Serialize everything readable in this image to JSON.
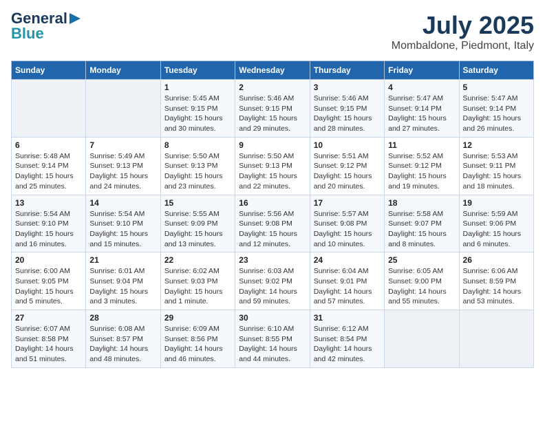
{
  "header": {
    "logo_line1": "General",
    "logo_line2": "Blue",
    "month": "July 2025",
    "location": "Mombaldone, Piedmont, Italy"
  },
  "weekdays": [
    "Sunday",
    "Monday",
    "Tuesday",
    "Wednesday",
    "Thursday",
    "Friday",
    "Saturday"
  ],
  "weeks": [
    [
      {
        "day": "",
        "info": ""
      },
      {
        "day": "",
        "info": ""
      },
      {
        "day": "1",
        "info": "Sunrise: 5:45 AM\nSunset: 9:15 PM\nDaylight: 15 hours\nand 30 minutes."
      },
      {
        "day": "2",
        "info": "Sunrise: 5:46 AM\nSunset: 9:15 PM\nDaylight: 15 hours\nand 29 minutes."
      },
      {
        "day": "3",
        "info": "Sunrise: 5:46 AM\nSunset: 9:15 PM\nDaylight: 15 hours\nand 28 minutes."
      },
      {
        "day": "4",
        "info": "Sunrise: 5:47 AM\nSunset: 9:14 PM\nDaylight: 15 hours\nand 27 minutes."
      },
      {
        "day": "5",
        "info": "Sunrise: 5:47 AM\nSunset: 9:14 PM\nDaylight: 15 hours\nand 26 minutes."
      }
    ],
    [
      {
        "day": "6",
        "info": "Sunrise: 5:48 AM\nSunset: 9:14 PM\nDaylight: 15 hours\nand 25 minutes."
      },
      {
        "day": "7",
        "info": "Sunrise: 5:49 AM\nSunset: 9:13 PM\nDaylight: 15 hours\nand 24 minutes."
      },
      {
        "day": "8",
        "info": "Sunrise: 5:50 AM\nSunset: 9:13 PM\nDaylight: 15 hours\nand 23 minutes."
      },
      {
        "day": "9",
        "info": "Sunrise: 5:50 AM\nSunset: 9:13 PM\nDaylight: 15 hours\nand 22 minutes."
      },
      {
        "day": "10",
        "info": "Sunrise: 5:51 AM\nSunset: 9:12 PM\nDaylight: 15 hours\nand 20 minutes."
      },
      {
        "day": "11",
        "info": "Sunrise: 5:52 AM\nSunset: 9:12 PM\nDaylight: 15 hours\nand 19 minutes."
      },
      {
        "day": "12",
        "info": "Sunrise: 5:53 AM\nSunset: 9:11 PM\nDaylight: 15 hours\nand 18 minutes."
      }
    ],
    [
      {
        "day": "13",
        "info": "Sunrise: 5:54 AM\nSunset: 9:10 PM\nDaylight: 15 hours\nand 16 minutes."
      },
      {
        "day": "14",
        "info": "Sunrise: 5:54 AM\nSunset: 9:10 PM\nDaylight: 15 hours\nand 15 minutes."
      },
      {
        "day": "15",
        "info": "Sunrise: 5:55 AM\nSunset: 9:09 PM\nDaylight: 15 hours\nand 13 minutes."
      },
      {
        "day": "16",
        "info": "Sunrise: 5:56 AM\nSunset: 9:08 PM\nDaylight: 15 hours\nand 12 minutes."
      },
      {
        "day": "17",
        "info": "Sunrise: 5:57 AM\nSunset: 9:08 PM\nDaylight: 15 hours\nand 10 minutes."
      },
      {
        "day": "18",
        "info": "Sunrise: 5:58 AM\nSunset: 9:07 PM\nDaylight: 15 hours\nand 8 minutes."
      },
      {
        "day": "19",
        "info": "Sunrise: 5:59 AM\nSunset: 9:06 PM\nDaylight: 15 hours\nand 6 minutes."
      }
    ],
    [
      {
        "day": "20",
        "info": "Sunrise: 6:00 AM\nSunset: 9:05 PM\nDaylight: 15 hours\nand 5 minutes."
      },
      {
        "day": "21",
        "info": "Sunrise: 6:01 AM\nSunset: 9:04 PM\nDaylight: 15 hours\nand 3 minutes."
      },
      {
        "day": "22",
        "info": "Sunrise: 6:02 AM\nSunset: 9:03 PM\nDaylight: 15 hours\nand 1 minute."
      },
      {
        "day": "23",
        "info": "Sunrise: 6:03 AM\nSunset: 9:02 PM\nDaylight: 14 hours\nand 59 minutes."
      },
      {
        "day": "24",
        "info": "Sunrise: 6:04 AM\nSunset: 9:01 PM\nDaylight: 14 hours\nand 57 minutes."
      },
      {
        "day": "25",
        "info": "Sunrise: 6:05 AM\nSunset: 9:00 PM\nDaylight: 14 hours\nand 55 minutes."
      },
      {
        "day": "26",
        "info": "Sunrise: 6:06 AM\nSunset: 8:59 PM\nDaylight: 14 hours\nand 53 minutes."
      }
    ],
    [
      {
        "day": "27",
        "info": "Sunrise: 6:07 AM\nSunset: 8:58 PM\nDaylight: 14 hours\nand 51 minutes."
      },
      {
        "day": "28",
        "info": "Sunrise: 6:08 AM\nSunset: 8:57 PM\nDaylight: 14 hours\nand 48 minutes."
      },
      {
        "day": "29",
        "info": "Sunrise: 6:09 AM\nSunset: 8:56 PM\nDaylight: 14 hours\nand 46 minutes."
      },
      {
        "day": "30",
        "info": "Sunrise: 6:10 AM\nSunset: 8:55 PM\nDaylight: 14 hours\nand 44 minutes."
      },
      {
        "day": "31",
        "info": "Sunrise: 6:12 AM\nSunset: 8:54 PM\nDaylight: 14 hours\nand 42 minutes."
      },
      {
        "day": "",
        "info": ""
      },
      {
        "day": "",
        "info": ""
      }
    ]
  ]
}
